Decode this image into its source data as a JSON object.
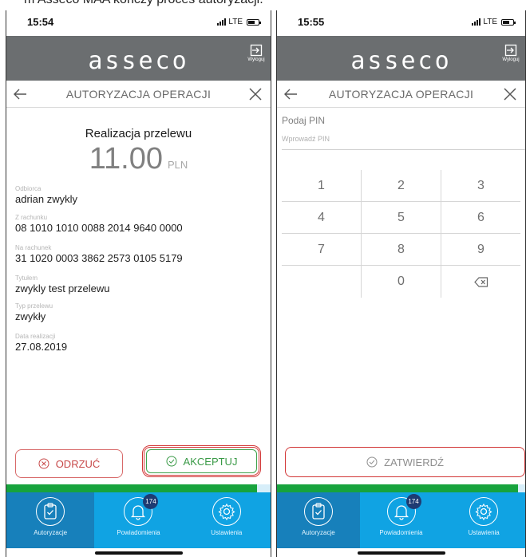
{
  "caption": "m Asseco MAA kończy proces autoryzacji.",
  "colors": {
    "topbar": "#6b6e70",
    "tabbar": "#10a3e3",
    "tab_active": "#1780bb",
    "accept": "#3a9a47",
    "reject": "#c74848",
    "highlight": "#d23636",
    "progress": "#17a33d"
  },
  "screen1": {
    "status": {
      "time": "15:54",
      "network": "LTE"
    },
    "header": {
      "logo": "asseco",
      "logout_label": "Wyloguj"
    },
    "nav": {
      "title": "AUTORYZACJA OPERACJI"
    },
    "transfer": {
      "heading": "Realizacja przelewu",
      "amount": "11.00",
      "currency": "PLN",
      "fields": [
        {
          "label": "Odbiorca",
          "value": "adrian zwykly"
        },
        {
          "label": "Z rachunku",
          "value": "08 1010 1010 0088 2014 9640 0000"
        },
        {
          "label": "Na rachunek",
          "value": "31 1020 0003 3862 2573 0105 5179"
        },
        {
          "label": "Tytułem",
          "value": "zwykly test przelewu"
        },
        {
          "label": "Typ przelewu",
          "value": "zwykły"
        },
        {
          "label": "Data realizacji",
          "value": "27.08.2019"
        }
      ]
    },
    "buttons": {
      "reject": "ODRZUĆ",
      "accept": "AKCEPTUJ"
    },
    "progress": 0.95,
    "tabs": [
      {
        "label": "Autoryzacje",
        "icon": "clipboard-check-icon"
      },
      {
        "label": "Powiadomienia",
        "icon": "bell-icon",
        "badge": "174"
      },
      {
        "label": "Ustawienia",
        "icon": "gear-icon"
      }
    ]
  },
  "screen2": {
    "status": {
      "time": "15:55",
      "network": "LTE"
    },
    "header": {
      "logo": "asseco",
      "logout_label": "Wyloguj"
    },
    "nav": {
      "title": "AUTORYZACJA OPERACJI"
    },
    "pin": {
      "label": "Podaj PIN",
      "placeholder": "Wprowadź PIN"
    },
    "keypad": [
      [
        "1",
        "2",
        "3"
      ],
      [
        "4",
        "5",
        "6"
      ],
      [
        "7",
        "8",
        "9"
      ],
      [
        "",
        "0",
        "⌫"
      ]
    ],
    "confirm": "ZATWIERDŹ",
    "progress": 0.97,
    "tabs": [
      {
        "label": "Autoryzacje",
        "icon": "clipboard-check-icon"
      },
      {
        "label": "Powiadomienia",
        "icon": "bell-icon",
        "badge": "174"
      },
      {
        "label": "Ustawienia",
        "icon": "gear-icon"
      }
    ]
  }
}
